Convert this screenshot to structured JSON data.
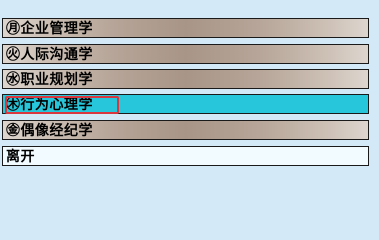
{
  "menu": {
    "items": [
      {
        "label": "㊊企业管理学"
      },
      {
        "label": "㊋人际沟通学"
      },
      {
        "label": "㊌职业规划学"
      },
      {
        "label": "㊍行为心理学"
      },
      {
        "label": "㊎偶像经纪学"
      },
      {
        "label": "离开"
      }
    ],
    "selected_index": 3,
    "colors": {
      "background": "#d3e9f7",
      "selected": "#27c6da",
      "highlight_border": "#d9363e"
    }
  }
}
